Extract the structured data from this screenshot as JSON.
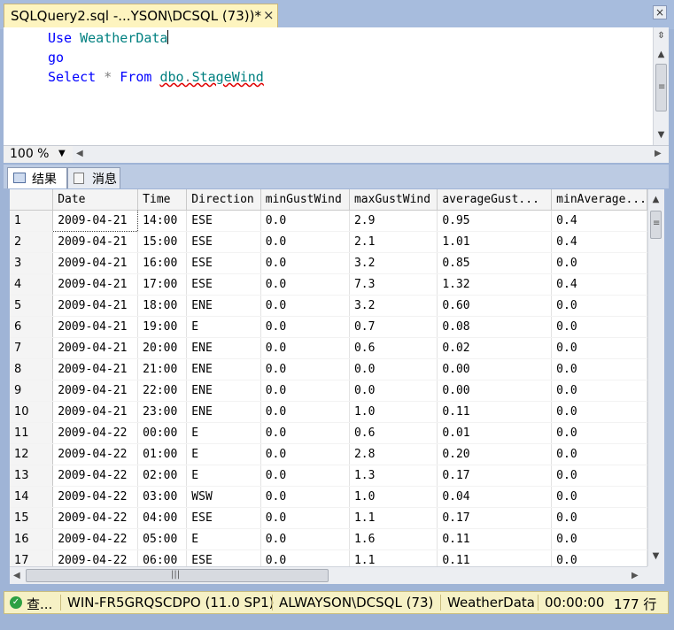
{
  "document_tab": {
    "title": "SQLQuery2.sql -...YSON\\DCSQL (73))*",
    "close_glyph": "×"
  },
  "editor": {
    "line1": {
      "kw": "Use",
      "db": "WeatherData"
    },
    "line2": {
      "kw": "go"
    },
    "line3": {
      "select": "Select",
      "star": "*",
      "from": "From",
      "schema": "dbo",
      "dot": ".",
      "table": "StageWind"
    }
  },
  "zoom": {
    "value": "100 %"
  },
  "results_tabs": [
    {
      "label": "结果"
    },
    {
      "label": "消息"
    }
  ],
  "grid": {
    "columns": [
      "Date",
      "Time",
      "Direction",
      "minGustWind",
      "maxGustWind",
      "averageGust...",
      "minAverage..."
    ],
    "rows": [
      [
        "1",
        "2009-04-21",
        "14:00",
        "ESE",
        "0.0",
        "2.9",
        "0.95",
        "0.4"
      ],
      [
        "2",
        "2009-04-21",
        "15:00",
        "ESE",
        "0.0",
        "2.1",
        "1.01",
        "0.4"
      ],
      [
        "3",
        "2009-04-21",
        "16:00",
        "ESE",
        "0.0",
        "3.2",
        "0.85",
        "0.0"
      ],
      [
        "4",
        "2009-04-21",
        "17:00",
        "ESE",
        "0.0",
        "7.3",
        "1.32",
        "0.4"
      ],
      [
        "5",
        "2009-04-21",
        "18:00",
        "ENE",
        "0.0",
        "3.2",
        "0.60",
        "0.0"
      ],
      [
        "6",
        "2009-04-21",
        "19:00",
        "E",
        "0.0",
        "0.7",
        "0.08",
        "0.0"
      ],
      [
        "7",
        "2009-04-21",
        "20:00",
        "ENE",
        "0.0",
        "0.6",
        "0.02",
        "0.0"
      ],
      [
        "8",
        "2009-04-21",
        "21:00",
        "ENE",
        "0.0",
        "0.0",
        "0.00",
        "0.0"
      ],
      [
        "9",
        "2009-04-21",
        "22:00",
        "ENE",
        "0.0",
        "0.0",
        "0.00",
        "0.0"
      ],
      [
        "10",
        "2009-04-21",
        "23:00",
        "ENE",
        "0.0",
        "1.0",
        "0.11",
        "0.0"
      ],
      [
        "11",
        "2009-04-22",
        "00:00",
        "E",
        "0.0",
        "0.6",
        "0.01",
        "0.0"
      ],
      [
        "12",
        "2009-04-22",
        "01:00",
        "E",
        "0.0",
        "2.8",
        "0.20",
        "0.0"
      ],
      [
        "13",
        "2009-04-22",
        "02:00",
        "E",
        "0.0",
        "1.3",
        "0.17",
        "0.0"
      ],
      [
        "14",
        "2009-04-22",
        "03:00",
        "WSW",
        "0.0",
        "1.0",
        "0.04",
        "0.0"
      ],
      [
        "15",
        "2009-04-22",
        "04:00",
        "ESE",
        "0.0",
        "1.1",
        "0.17",
        "0.0"
      ],
      [
        "16",
        "2009-04-22",
        "05:00",
        "E",
        "0.0",
        "1.6",
        "0.11",
        "0.0"
      ],
      [
        "17",
        "2009-04-22",
        "06:00",
        "ESE",
        "0.0",
        "1.1",
        "0.11",
        "0.0"
      ]
    ]
  },
  "status": {
    "state": "查...",
    "server": "WIN-FR5GRQSCDPO (11.0 SP1)",
    "connection": "ALWAYSON\\DCSQL (73)",
    "database": "WeatherData",
    "elapsed": "00:00:00",
    "rows": "177 行"
  },
  "colors": {
    "status_ok": "#2ea043",
    "keyword": "#0000ff",
    "object": "#008080",
    "tab_active": "#fdf4bf"
  }
}
